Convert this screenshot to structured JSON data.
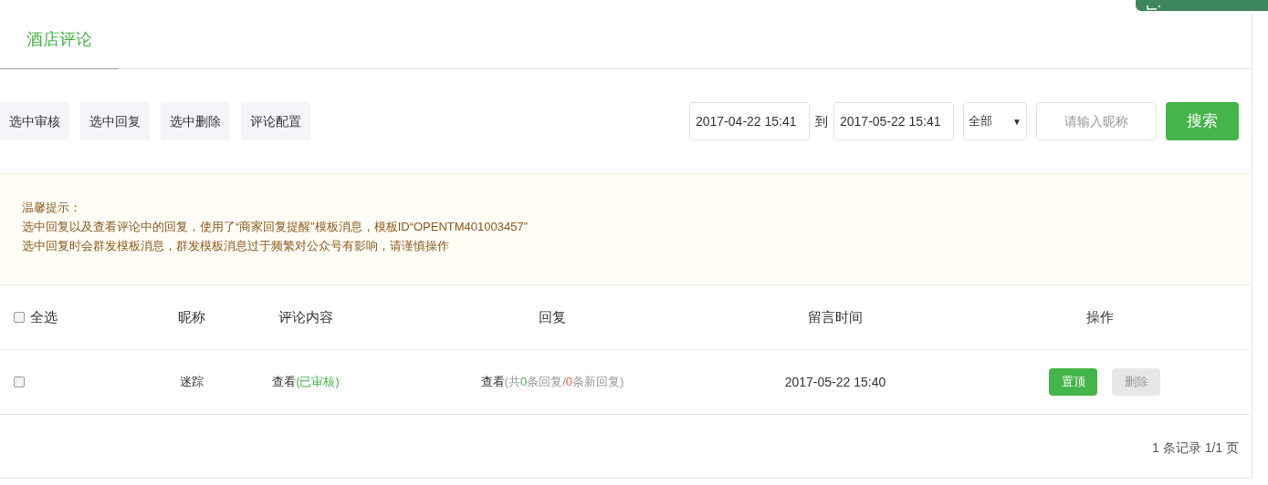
{
  "tabs": [
    {
      "label": "酒店评论",
      "selected": true
    }
  ],
  "actions": [
    "选中审核",
    "选中回复",
    "选中删除",
    "评论配置"
  ],
  "filter": {
    "from": "2017-04-22 15:41",
    "to_label": "到",
    "to": "2017-05-22 15:41",
    "status": "全部",
    "status_caret": "▼",
    "nickname_placeholder": "请输入昵称",
    "search": "搜索"
  },
  "notice": {
    "title": "温馨提示：",
    "lines": [
      "选中回复以及查看评论中的回复，使用了“商家回复提醒”模板消息，模板ID“OPENTM401003457”",
      "选中回复时会群发模板消息，群发模板消息过于频繁对公众号有影响，请谨慎操作"
    ]
  },
  "table": {
    "select_all": {
      "label": "全选",
      "checked": false
    },
    "columns": [
      "昵称",
      "评论内容",
      "回复",
      "留言时间",
      "操作"
    ],
    "rows": [
      {
        "checked": false,
        "nickname": "迷踪",
        "comment": [
          {
            "text": "查看",
            "kind": "link"
          },
          {
            "text": "(已审核)",
            "kind": "ok"
          }
        ],
        "reply": [
          {
            "text": "查看",
            "kind": "link"
          },
          {
            "text": "(共",
            "kind": "muted"
          },
          {
            "text": "0",
            "kind": "ok"
          },
          {
            "text": "条回复/",
            "kind": "muted"
          },
          {
            "text": "0",
            "kind": "alert"
          },
          {
            "text": "条新回复)",
            "kind": "muted"
          }
        ],
        "time": "2017-05-22 15:40",
        "buttons": [
          {
            "label": "置顶",
            "disabled": false
          },
          {
            "label": "删除",
            "disabled": true
          }
        ]
      }
    ]
  },
  "pagination": "1 条记录 1/1 页"
}
